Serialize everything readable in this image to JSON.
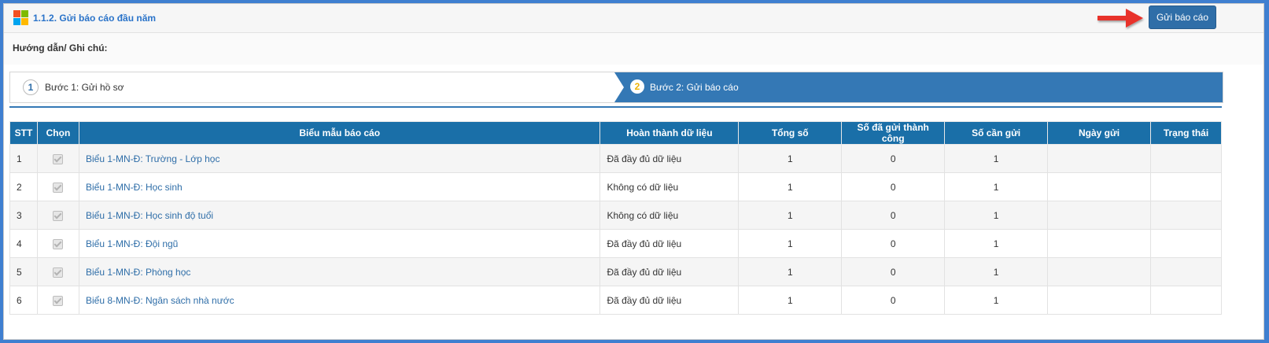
{
  "header": {
    "title": "1.1.2. Gửi báo cáo đầu năm",
    "send_button": "Gửi báo cáo",
    "logo_colors": [
      "#f25022",
      "#7fba00",
      "#00a4ef",
      "#ffb900"
    ]
  },
  "guide": {
    "label": "Hướng dẫn/ Ghi chú:"
  },
  "wizard": {
    "steps": [
      {
        "number": "1",
        "label": "Bước 1: Gửi hồ sơ"
      },
      {
        "number": "2",
        "label": "Bước 2: Gửi báo cáo"
      }
    ],
    "active_color": "#3478b5"
  },
  "table": {
    "columns": [
      "STT",
      "Chọn",
      "Biểu mẫu báo cáo",
      "Hoàn thành dữ liệu",
      "Tổng số",
      "Số đã gửi thành công",
      "Số cần gửi",
      "Ngày gửi",
      "Trạng thái"
    ],
    "rows": [
      {
        "stt": "1",
        "form": "Biểu 1-MN-Đ: Trường - Lớp học",
        "status_data": "Đã đầy đủ dữ liệu",
        "total": "1",
        "sent": "0",
        "to_send": "1",
        "date": "",
        "state": ""
      },
      {
        "stt": "2",
        "form": "Biểu 1-MN-Đ: Học sinh",
        "status_data": "Không có dữ liệu",
        "total": "1",
        "sent": "0",
        "to_send": "1",
        "date": "",
        "state": ""
      },
      {
        "stt": "3",
        "form": "Biểu 1-MN-Đ: Học sinh độ tuổi",
        "status_data": "Không có dữ liệu",
        "total": "1",
        "sent": "0",
        "to_send": "1",
        "date": "",
        "state": ""
      },
      {
        "stt": "4",
        "form": "Biểu 1-MN-Đ: Đội ngũ",
        "status_data": "Đã đầy đủ dữ liệu",
        "total": "1",
        "sent": "0",
        "to_send": "1",
        "date": "",
        "state": ""
      },
      {
        "stt": "5",
        "form": "Biểu 1-MN-Đ: Phòng học",
        "status_data": "Đã đầy đủ dữ liệu",
        "total": "1",
        "sent": "0",
        "to_send": "1",
        "date": "",
        "state": ""
      },
      {
        "stt": "6",
        "form": "Biểu 8-MN-Đ: Ngân sách nhà nước",
        "status_data": "Đã đầy đủ dữ liệu",
        "total": "1",
        "sent": "0",
        "to_send": "1",
        "date": "",
        "state": ""
      }
    ],
    "header_color": "#1a6fa8"
  },
  "annotation": {
    "arrow_icon": "red-arrow-icon",
    "color": "#e8302a"
  }
}
